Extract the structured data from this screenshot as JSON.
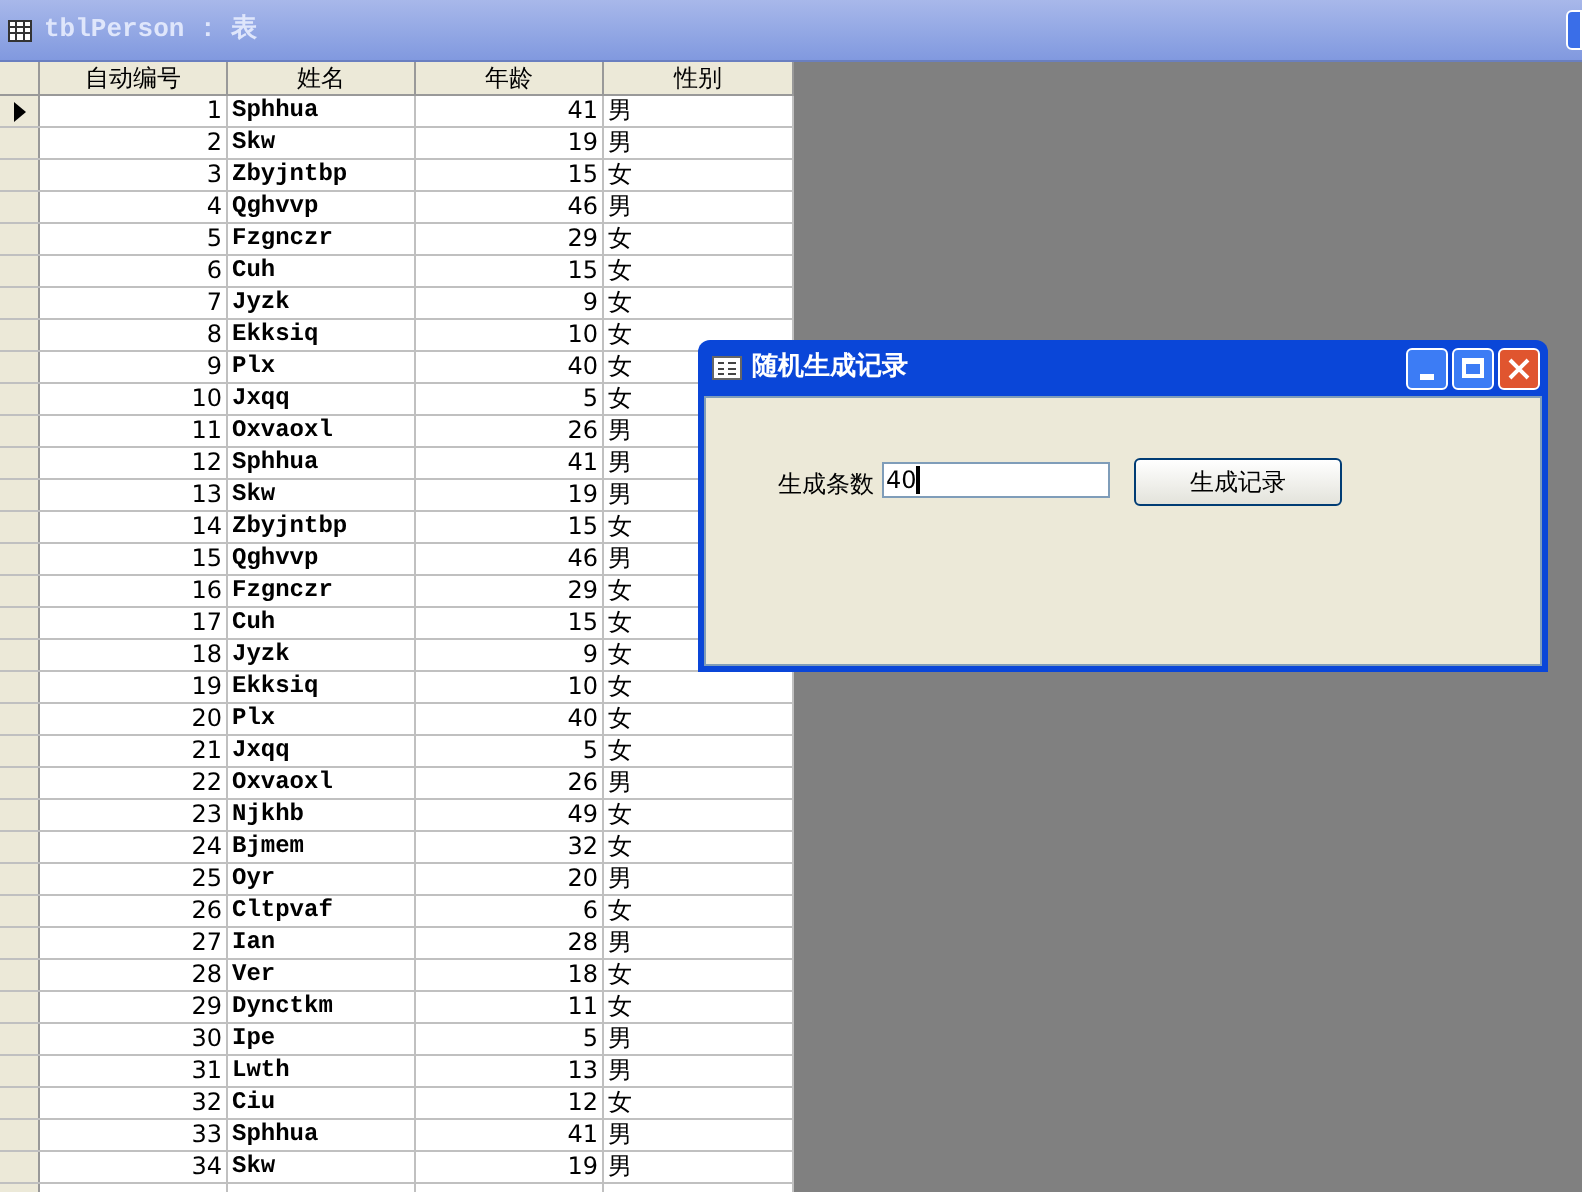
{
  "window": {
    "title": "tblPerson : 表"
  },
  "table": {
    "columns": [
      "自动编号",
      "姓名",
      "年龄",
      "性别"
    ],
    "rows": [
      {
        "cells": [
          "1",
          "Sphhua",
          "41",
          "男"
        ],
        "selected": true
      },
      {
        "cells": [
          "2",
          "Skw",
          "19",
          "男"
        ],
        "selected": false
      },
      {
        "cells": [
          "3",
          "Zbyjntbp",
          "15",
          "女"
        ],
        "selected": false
      },
      {
        "cells": [
          "4",
          "Qghvvp",
          "46",
          "男"
        ],
        "selected": false
      },
      {
        "cells": [
          "5",
          "Fzgnczr",
          "29",
          "女"
        ],
        "selected": false
      },
      {
        "cells": [
          "6",
          "Cuh",
          "15",
          "女"
        ],
        "selected": false
      },
      {
        "cells": [
          "7",
          "Jyzk",
          "9",
          "女"
        ],
        "selected": false
      },
      {
        "cells": [
          "8",
          "Ekksiq",
          "10",
          "女"
        ],
        "selected": false
      },
      {
        "cells": [
          "9",
          "Plx",
          "40",
          "女"
        ],
        "selected": false
      },
      {
        "cells": [
          "10",
          "Jxqq",
          "5",
          "女"
        ],
        "selected": false
      },
      {
        "cells": [
          "11",
          "Oxvaoxl",
          "26",
          "男"
        ],
        "selected": false
      },
      {
        "cells": [
          "12",
          "Sphhua",
          "41",
          "男"
        ],
        "selected": false
      },
      {
        "cells": [
          "13",
          "Skw",
          "19",
          "男"
        ],
        "selected": false
      },
      {
        "cells": [
          "14",
          "Zbyjntbp",
          "15",
          "女"
        ],
        "selected": false
      },
      {
        "cells": [
          "15",
          "Qghvvp",
          "46",
          "男"
        ],
        "selected": false
      },
      {
        "cells": [
          "16",
          "Fzgnczr",
          "29",
          "女"
        ],
        "selected": false
      },
      {
        "cells": [
          "17",
          "Cuh",
          "15",
          "女"
        ],
        "selected": false
      },
      {
        "cells": [
          "18",
          "Jyzk",
          "9",
          "女"
        ],
        "selected": false
      },
      {
        "cells": [
          "19",
          "Ekksiq",
          "10",
          "女"
        ],
        "selected": false
      },
      {
        "cells": [
          "20",
          "Plx",
          "40",
          "女"
        ],
        "selected": false
      },
      {
        "cells": [
          "21",
          "Jxqq",
          "5",
          "女"
        ],
        "selected": false
      },
      {
        "cells": [
          "22",
          "Oxvaoxl",
          "26",
          "男"
        ],
        "selected": false
      },
      {
        "cells": [
          "23",
          "Njkhb",
          "49",
          "女"
        ],
        "selected": false
      },
      {
        "cells": [
          "24",
          "Bjmem",
          "32",
          "女"
        ],
        "selected": false
      },
      {
        "cells": [
          "25",
          "Oyr",
          "20",
          "男"
        ],
        "selected": false
      },
      {
        "cells": [
          "26",
          "Cltpvaf",
          "6",
          "女"
        ],
        "selected": false
      },
      {
        "cells": [
          "27",
          "Ian",
          "28",
          "男"
        ],
        "selected": false
      },
      {
        "cells": [
          "28",
          "Ver",
          "18",
          "女"
        ],
        "selected": false
      },
      {
        "cells": [
          "29",
          "Dynctkm",
          "11",
          "女"
        ],
        "selected": false
      },
      {
        "cells": [
          "30",
          "Ipe",
          "5",
          "男"
        ],
        "selected": false
      },
      {
        "cells": [
          "31",
          "Lwth",
          "13",
          "男"
        ],
        "selected": false
      },
      {
        "cells": [
          "32",
          "Ciu",
          "12",
          "女"
        ],
        "selected": false
      },
      {
        "cells": [
          "33",
          "Sphhua",
          "41",
          "男"
        ],
        "selected": false
      },
      {
        "cells": [
          "34",
          "Skw",
          "19",
          "男"
        ],
        "selected": false
      }
    ]
  },
  "dialog": {
    "title": "随机生成记录",
    "label": "生成条数",
    "value": "40",
    "button": "生成记录"
  }
}
